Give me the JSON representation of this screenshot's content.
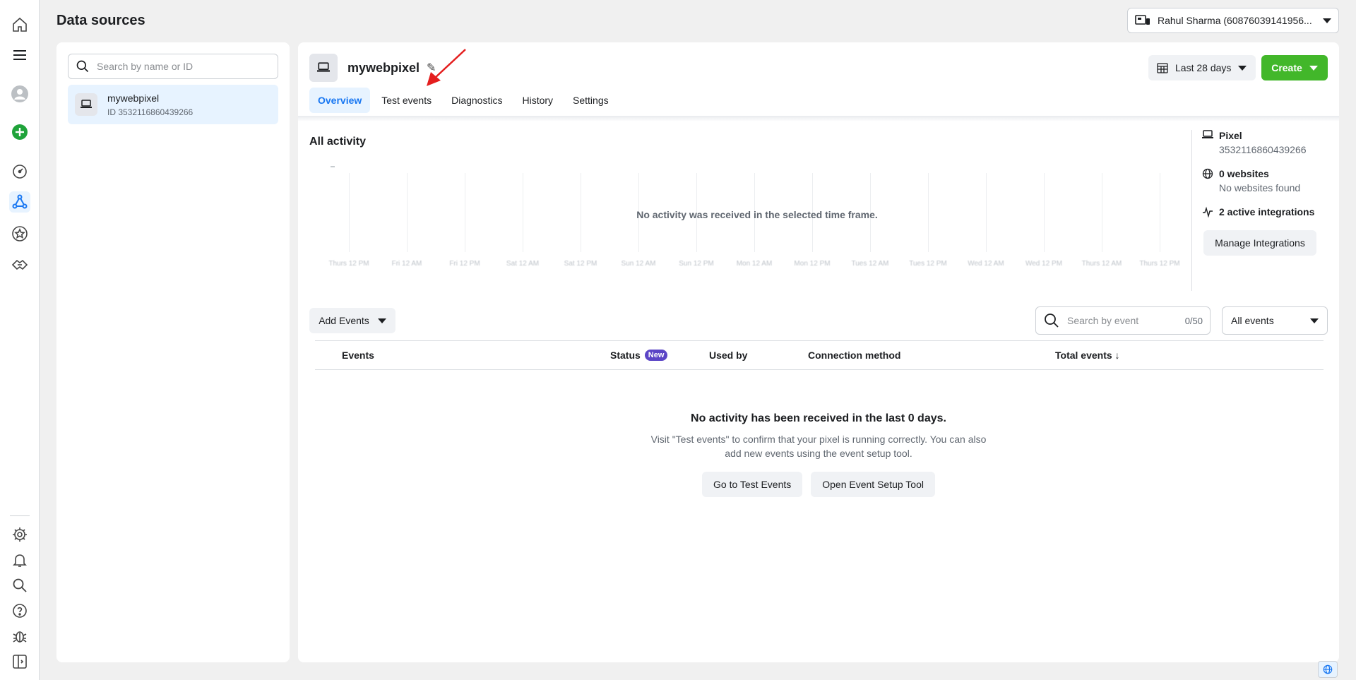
{
  "header": {
    "title": "Data sources",
    "account": "Rahul Sharma (60876039141956..."
  },
  "left_panel": {
    "search_placeholder": "Search by name or ID",
    "items": [
      {
        "name": "mywebpixel",
        "id": "ID 3532116860439266"
      }
    ]
  },
  "pixel": {
    "name": "mywebpixel",
    "date_range": "Last 28 days",
    "create_label": "Create"
  },
  "tabs": [
    {
      "label": "Overview",
      "active": true
    },
    {
      "label": "Test events",
      "active": false
    },
    {
      "label": "Diagnostics",
      "active": false
    },
    {
      "label": "History",
      "active": false
    },
    {
      "label": "Settings",
      "active": false
    }
  ],
  "activity": {
    "title": "All activity",
    "empty_message": "No activity was received in the selected time frame.",
    "ticks": [
      "Thurs 12 PM",
      "Fri 12 AM",
      "Fri 12 PM",
      "Sat 12 AM",
      "Sat 12 PM",
      "Sun 12 AM",
      "Sun 12 PM",
      "Mon 12 AM",
      "Mon 12 PM",
      "Tues 12 AM",
      "Tues 12 PM",
      "Wed 12 AM",
      "Wed 12 PM",
      "Thurs 12 AM",
      "Thurs 12 PM"
    ]
  },
  "info": {
    "pixel_label": "Pixel",
    "pixel_id": "3532116860439266",
    "websites_label": "0 websites",
    "websites_sub": "No websites found",
    "integrations_label": "2 active integrations",
    "manage_label": "Manage Integrations"
  },
  "events": {
    "add_label": "Add Events",
    "search_placeholder": "Search by event",
    "count": "0/50",
    "filter_label": "All events",
    "columns": {
      "events": "Events",
      "status": "Status",
      "new_badge": "New",
      "used_by": "Used by",
      "connection": "Connection method",
      "total": "Total events ↓"
    },
    "empty_title": "No activity has been received in the last 0 days.",
    "empty_text": "Visit \"Test events\" to confirm that your pixel is running correctly. You can also add new events using the event setup tool.",
    "btn_test": "Go to Test Events",
    "btn_setup": "Open Event Setup Tool"
  },
  "colors": {
    "accent": "#1877f2",
    "create": "#42b72a",
    "annotation": "#e41e1e",
    "badge": "#5b45c6"
  }
}
